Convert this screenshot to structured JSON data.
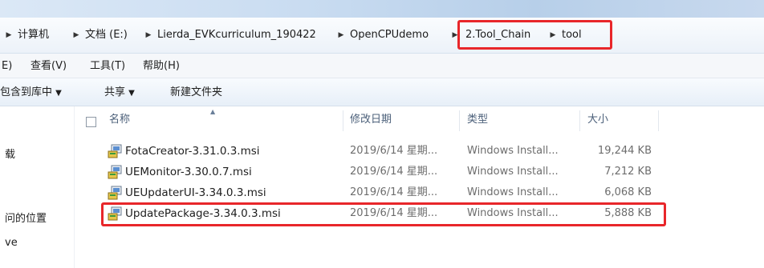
{
  "address_bar": {
    "crumbs": [
      "计算机",
      "文档 (E:)",
      "Lierda_EVKcurriculum_190422",
      "OpenCPUdemo",
      "2.Tool_Chain",
      "tool"
    ]
  },
  "menu": {
    "items": [
      "E)",
      "查看(V)",
      "工具(T)",
      "帮助(H)"
    ]
  },
  "toolbar": {
    "include_library": "包含到库中",
    "share": "共享",
    "new_folder": "新建文件夹"
  },
  "nav_pane": {
    "items": [
      "载",
      "问的位置",
      "ve"
    ]
  },
  "columns": {
    "name": "名称",
    "date": "修改日期",
    "type": "类型",
    "size": "大小"
  },
  "files": [
    {
      "name": "FotaCreator-3.31.0.3.msi",
      "date": "2019/6/14 星期...",
      "type": "Windows Install...",
      "size": "19,244 KB"
    },
    {
      "name": "UEMonitor-3.30.0.7.msi",
      "date": "2019/6/14 星期...",
      "type": "Windows Install...",
      "size": "7,212 KB"
    },
    {
      "name": "UEUpdaterUI-3.34.0.3.msi",
      "date": "2019/6/14 星期...",
      "type": "Windows Install...",
      "size": "6,068 KB"
    },
    {
      "name": "UpdatePackage-3.34.0.3.msi",
      "date": "2019/6/14 星期...",
      "type": "Windows Install...",
      "size": "5,888 KB"
    }
  ],
  "colors": {
    "highlight": "#e8262a"
  },
  "icons": {
    "breadcrumb_separator": "triangle-right-icon",
    "file": "msi-installer-icon",
    "dropdown": "triangle-down-icon"
  }
}
